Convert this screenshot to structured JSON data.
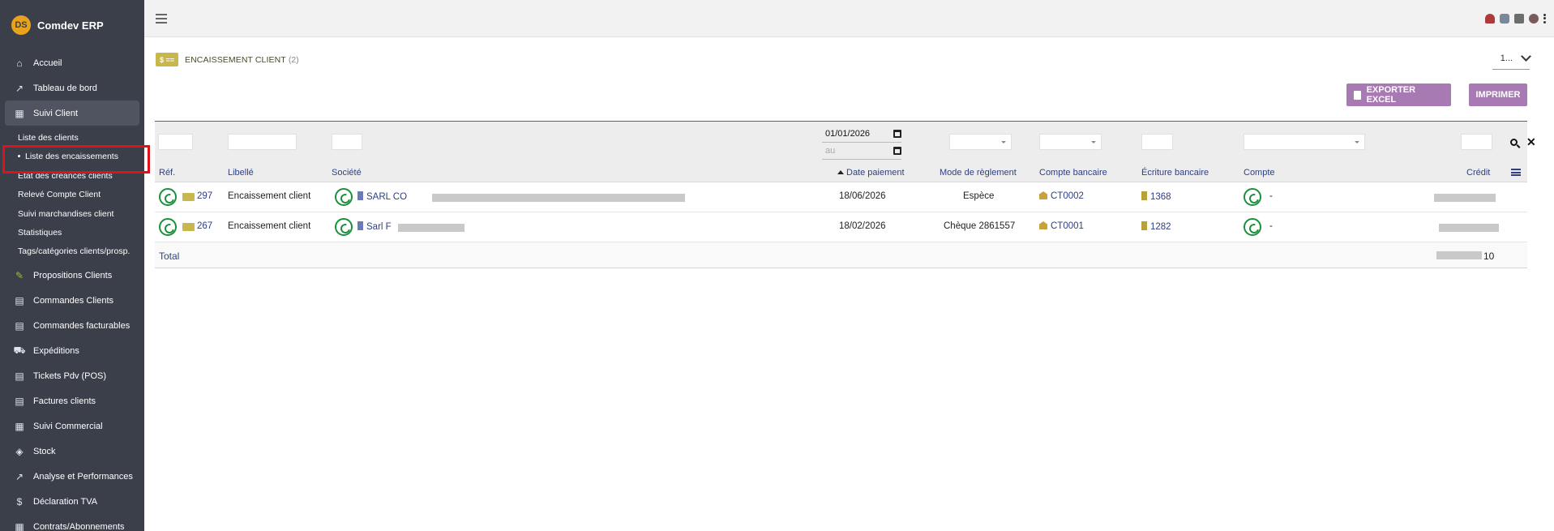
{
  "app": {
    "name": "Comdev ERP",
    "logo_text": "DS"
  },
  "sidebar": {
    "items": [
      {
        "label": "Accueil",
        "icon": "home-icon",
        "glyph": "⌂"
      },
      {
        "label": "Tableau de bord",
        "icon": "chart-line-icon",
        "glyph": "↗"
      },
      {
        "label": "Suivi Client",
        "icon": "building-icon",
        "glyph": "▦"
      },
      {
        "label": "Propositions Clients",
        "icon": "proposal-icon",
        "glyph": "✎"
      },
      {
        "label": "Commandes Clients",
        "icon": "document-icon",
        "glyph": "▤"
      },
      {
        "label": "Commandes facturables",
        "icon": "document-icon",
        "glyph": "▤"
      },
      {
        "label": "Expéditions",
        "icon": "dolly-icon",
        "glyph": "⛟"
      },
      {
        "label": "Tickets Pdv (POS)",
        "icon": "document-icon",
        "glyph": "▤"
      },
      {
        "label": "Factures clients",
        "icon": "document-icon",
        "glyph": "▤"
      },
      {
        "label": "Suivi Commercial",
        "icon": "building-icon",
        "glyph": "▦"
      },
      {
        "label": "Stock",
        "icon": "box-icon",
        "glyph": "◈"
      },
      {
        "label": "Analyse et Performances",
        "icon": "chart-line-icon",
        "glyph": "↗"
      },
      {
        "label": "Déclaration TVA",
        "icon": "money-icon",
        "glyph": "$"
      },
      {
        "label": "Contrats/Abonnements",
        "icon": "building-icon",
        "glyph": "▦"
      }
    ],
    "submenu": [
      "Liste des clients",
      "Liste des encaissements",
      "Etat des créances clients",
      "Relevé Compte Client",
      "Suivi marchandises client",
      "Statistiques",
      "Tags/catégories clients/prosp."
    ]
  },
  "page": {
    "title": "ENCAISSEMENT CLIENT",
    "count": "(2)",
    "head_icon_text": "$ ==",
    "pager_value": "1...",
    "export_label": "EXPORTER EXCEL",
    "print_label": "IMPRIMER"
  },
  "filters": {
    "date_from": "01/01/2026",
    "date_to_placeholder": "au"
  },
  "columns": {
    "ref": "Réf.",
    "libelle": "Libellé",
    "societe": "Société",
    "date": "Date paiement",
    "mode": "Mode de règlement",
    "compte_bancaire": "Compte bancaire",
    "ecriture": "Écriture bancaire",
    "compte": "Compte",
    "credit": "Crédit"
  },
  "rows": [
    {
      "ref": "297",
      "libelle": "Encaissement client",
      "societe": "SARL CO",
      "date": "18/06/2026",
      "mode": "Espèce",
      "compte_bancaire": "CT0002",
      "ecriture": "1368",
      "compte": "-"
    },
    {
      "ref": "267",
      "libelle": "Encaissement client",
      "societe": "Sarl F",
      "date": "18/02/2026",
      "mode": "Chèque 2861557",
      "compte_bancaire": "CT0001",
      "ecriture": "1282",
      "compte": "-"
    }
  ],
  "total": {
    "label": "Total",
    "credit_suffix": "10"
  },
  "colors": {
    "sidebar": "#3b3f4a",
    "accent_button": "#a87ab3",
    "link": "#2e3f82",
    "highlight": "#e0111b",
    "payment_icon": "#c8b74c"
  }
}
